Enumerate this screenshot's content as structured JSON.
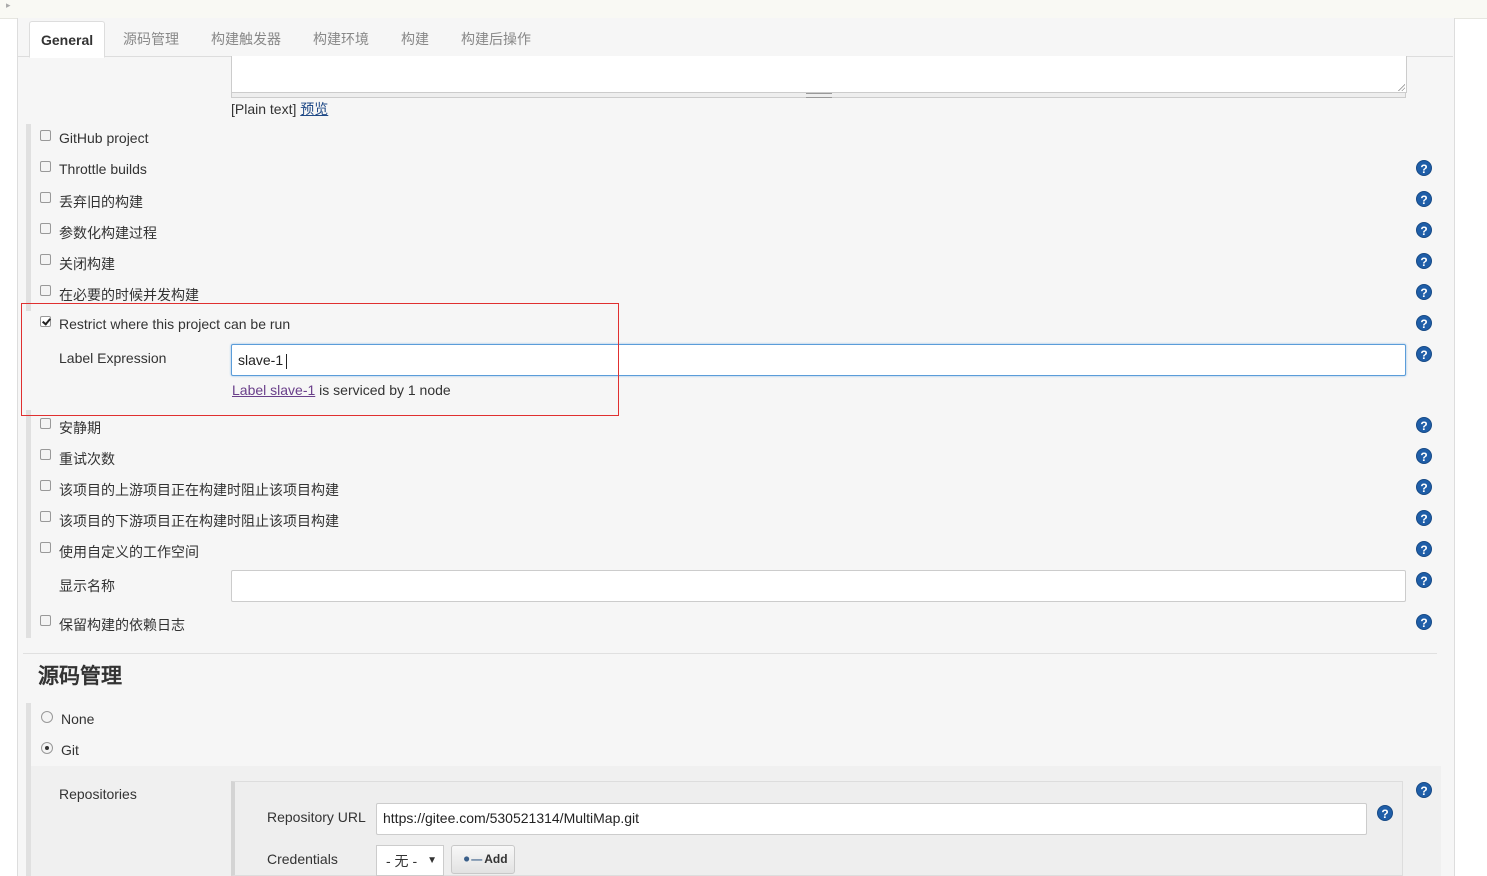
{
  "tabs": [
    "General",
    "源码管理",
    "构建触发器",
    "构建环境",
    "构建",
    "构建后操作"
  ],
  "description": {
    "value": "",
    "format_note": "[Plain text]",
    "preview_link": "预览"
  },
  "options_top": [
    {
      "label": "GitHub project",
      "checked": false,
      "help": false
    },
    {
      "label": "Throttle builds",
      "checked": false,
      "help": true
    },
    {
      "label": "丢弃旧的构建",
      "checked": false,
      "help": true
    },
    {
      "label": "参数化构建过程",
      "checked": false,
      "help": true
    },
    {
      "label": "关闭构建",
      "checked": false,
      "help": true
    },
    {
      "label": "在必要的时候并发构建",
      "checked": false,
      "help": true
    },
    {
      "label": "Restrict where this project can be run",
      "checked": true,
      "help": true
    }
  ],
  "restrict": {
    "label_expression_label": "Label Expression",
    "label_expression_value": "slave-1",
    "service_link": "Label slave-1",
    "service_text": " is serviced by 1 node"
  },
  "options_bottom": [
    {
      "label": "安静期",
      "checked": false
    },
    {
      "label": "重试次数",
      "checked": false
    },
    {
      "label": "该项目的上游项目正在构建时阻止该项目构建",
      "checked": false
    },
    {
      "label": "该项目的下游项目正在构建时阻止该项目构建",
      "checked": false
    },
    {
      "label": "使用自定义的工作空间",
      "checked": false
    }
  ],
  "display_name": {
    "label": "显示名称",
    "value": ""
  },
  "keep_deps": {
    "label": "保留构建的依赖日志",
    "checked": false
  },
  "scm": {
    "title": "源码管理",
    "options": [
      {
        "label": "None",
        "selected": false
      },
      {
        "label": "Git",
        "selected": true
      }
    ],
    "repositories_label": "Repositories",
    "repo_url_label": "Repository URL",
    "repo_url_value": "https://gitee.com/530521314/MultiMap.git",
    "credentials_label": "Credentials",
    "credentials_value": "- 无 -",
    "add_button_label": "Add"
  }
}
